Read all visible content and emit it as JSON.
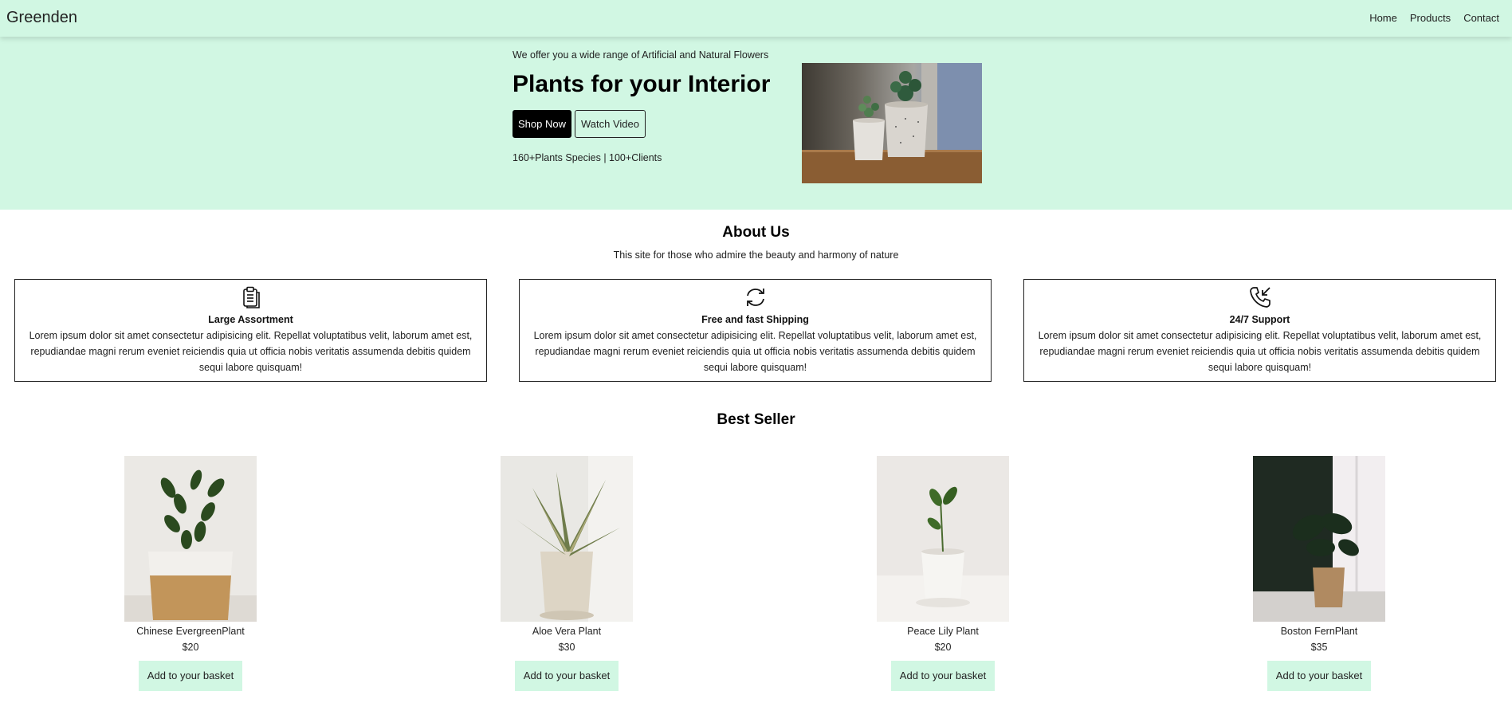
{
  "navbar": {
    "brand": "Greenden",
    "links": [
      "Home",
      "Products",
      "Contact"
    ]
  },
  "hero": {
    "tagline": "We offer you a wide range of Artificial and Natural Flowers",
    "title": "Plants for your Interior",
    "shop_button": "Shop Now",
    "watch_button": "Watch Video",
    "stats": "160+Plants Species | 100+Clients"
  },
  "about": {
    "title": "About Us",
    "subtitle": "This site for those who admire the beauty and harmony of nature",
    "features": [
      {
        "icon": "clipboard-icon",
        "title": "Large Assortment",
        "text": "Lorem ipsum dolor sit amet consectetur adipisicing elit. Repellat voluptatibus velit, laborum amet est, repudiandae magni rerum eveniet reiciendis quia ut officia nobis veritatis assumenda debitis quidem sequi labore quisquam!"
      },
      {
        "icon": "refresh-icon",
        "title": "Free and fast Shipping",
        "text": "Lorem ipsum dolor sit amet consectetur adipisicing elit. Repellat voluptatibus velit, laborum amet est, repudiandae magni rerum eveniet reiciendis quia ut officia nobis veritatis assumenda debitis quidem sequi labore quisquam!"
      },
      {
        "icon": "phone-incoming-icon",
        "title": "24/7 Support",
        "text": "Lorem ipsum dolor sit amet consectetur adipisicing elit. Repellat voluptatibus velit, laborum amet est, repudiandae magni rerum eveniet reiciendis quia ut officia nobis veritatis assumenda debitis quidem sequi labore quisquam!"
      }
    ]
  },
  "bestseller": {
    "title": "Best Seller",
    "products": [
      {
        "name": "Chinese EvergreenPlant",
        "price": "$20",
        "button": "Add to your basket"
      },
      {
        "name": "Aloe Vera Plant",
        "price": "$30",
        "button": "Add to your basket"
      },
      {
        "name": "Peace Lily Plant",
        "price": "$20",
        "button": "Add to your basket"
      },
      {
        "name": "Boston FernPlant",
        "price": "$35",
        "button": "Add to your basket"
      }
    ]
  },
  "colors": {
    "accent_mint": "#d1f7e3",
    "primary_button": "#000000",
    "text": "#222222"
  }
}
